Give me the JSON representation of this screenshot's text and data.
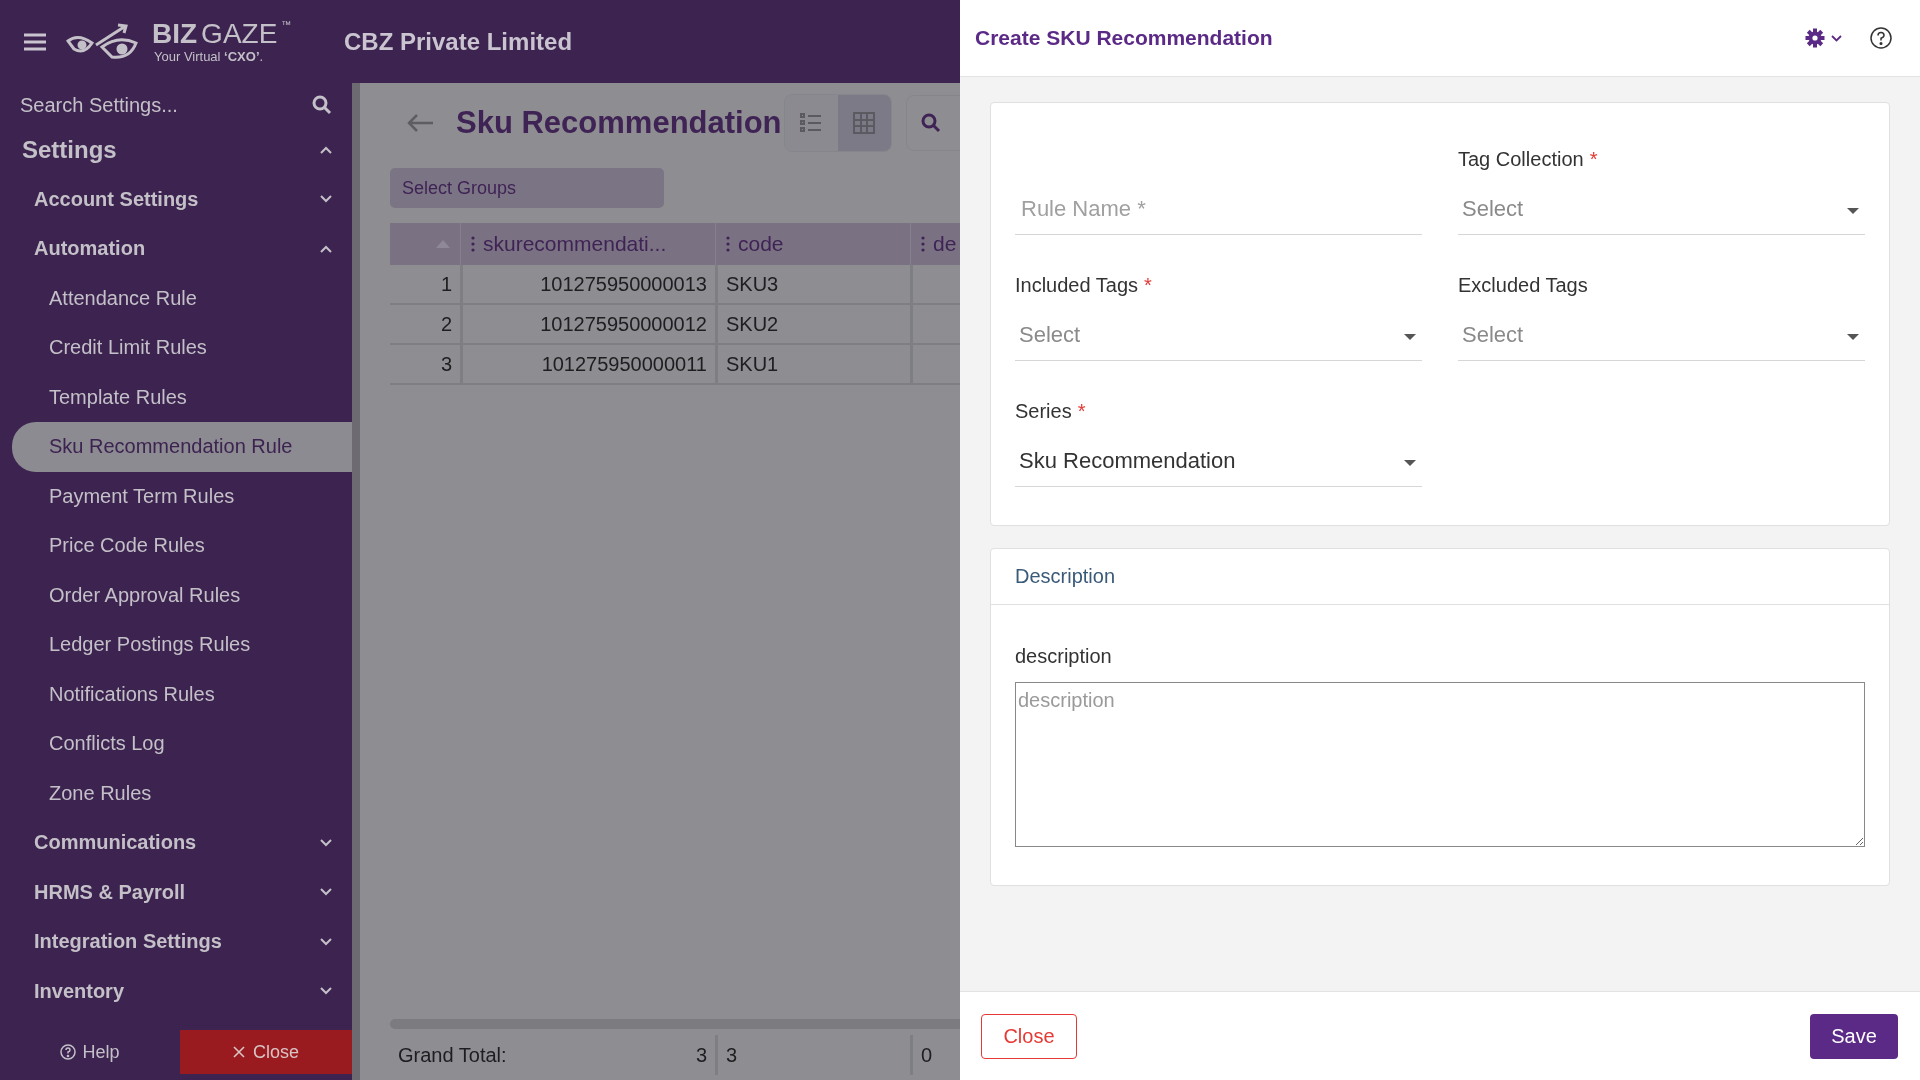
{
  "top_bar": {
    "logo": {
      "brand_bold": "BIZ",
      "brand_light": "GAZE",
      "trademark": "™",
      "tagline": "Your Virtual **‘CXO’**."
    },
    "company": "CBZ Private Limited"
  },
  "sidebar": {
    "search": {
      "placeholder": "Search Settings..."
    },
    "items": [
      {
        "label": "Settings",
        "expanded": true,
        "children": [
          {
            "label": "Account Settings",
            "expanded": false
          },
          {
            "label": "Automation",
            "expanded": true,
            "children": [
              {
                "label": "Attendance Rule",
                "selected": false
              },
              {
                "label": "Credit Limit Rules",
                "selected": false
              },
              {
                "label": "Template Rules",
                "selected": false
              },
              {
                "label": "Sku Recommendation Rule",
                "selected": true
              },
              {
                "label": "Payment Term Rules",
                "selected": false
              },
              {
                "label": "Price Code Rules",
                "selected": false
              },
              {
                "label": "Order Approval Rules",
                "selected": false
              },
              {
                "label": "Ledger Postings Rules",
                "selected": false
              },
              {
                "label": "Notifications Rules",
                "selected": false
              },
              {
                "label": "Conflicts Log",
                "selected": false
              },
              {
                "label": "Zone Rules",
                "selected": false
              }
            ]
          },
          {
            "label": "Communications",
            "expanded": false
          },
          {
            "label": "HRMS & Payroll",
            "expanded": false
          },
          {
            "label": "Integration Settings",
            "expanded": false
          },
          {
            "label": "Inventory",
            "expanded": false
          }
        ]
      }
    ],
    "footer": {
      "help": "Help",
      "close": "Close"
    }
  },
  "main": {
    "title": "Sku Recommendation",
    "views": [
      {
        "kind": "list",
        "selected": false
      },
      {
        "kind": "grid",
        "selected": true
      }
    ],
    "search_button": {
      "kind": "search"
    },
    "group_select": {
      "placeholder": "Select Groups"
    },
    "table": {
      "columns": [
        "skurecommendati...",
        "code",
        "de"
      ],
      "rows": [
        {
          "index": "1",
          "id": "101275950000013",
          "code": "SKU3"
        },
        {
          "index": "2",
          "id": "101275950000012",
          "code": "SKU2"
        },
        {
          "index": "3",
          "id": "101275950000011",
          "code": "SKU1"
        }
      ],
      "footer": {
        "label": "Grand Total:",
        "cells": [
          "3",
          "3",
          "0"
        ]
      }
    }
  },
  "drawer": {
    "title": "Create SKU Recommendation",
    "field_rows": [
      {
        "fields": [
          {
            "kind": "text",
            "placeholder": "Rule Name *"
          },
          {
            "kind": "select",
            "label": "Tag Collection",
            "required_mark": "*",
            "placeholder": "Select"
          }
        ]
      },
      {
        "fields": [
          {
            "kind": "select",
            "label": "Included Tags",
            "required_mark": "*",
            "placeholder": "Select"
          },
          {
            "kind": "select",
            "label": "Excluded Tags",
            "placeholder": "Select"
          }
        ]
      },
      {
        "fields": [
          {
            "kind": "select",
            "label": "Series",
            "required_mark": "*",
            "value": "Sku Recommendation"
          }
        ]
      }
    ],
    "description": {
      "heading": "Description",
      "label": "description",
      "placeholder": "description"
    },
    "buttons": {
      "close": "Close",
      "save": "Save"
    }
  }
}
